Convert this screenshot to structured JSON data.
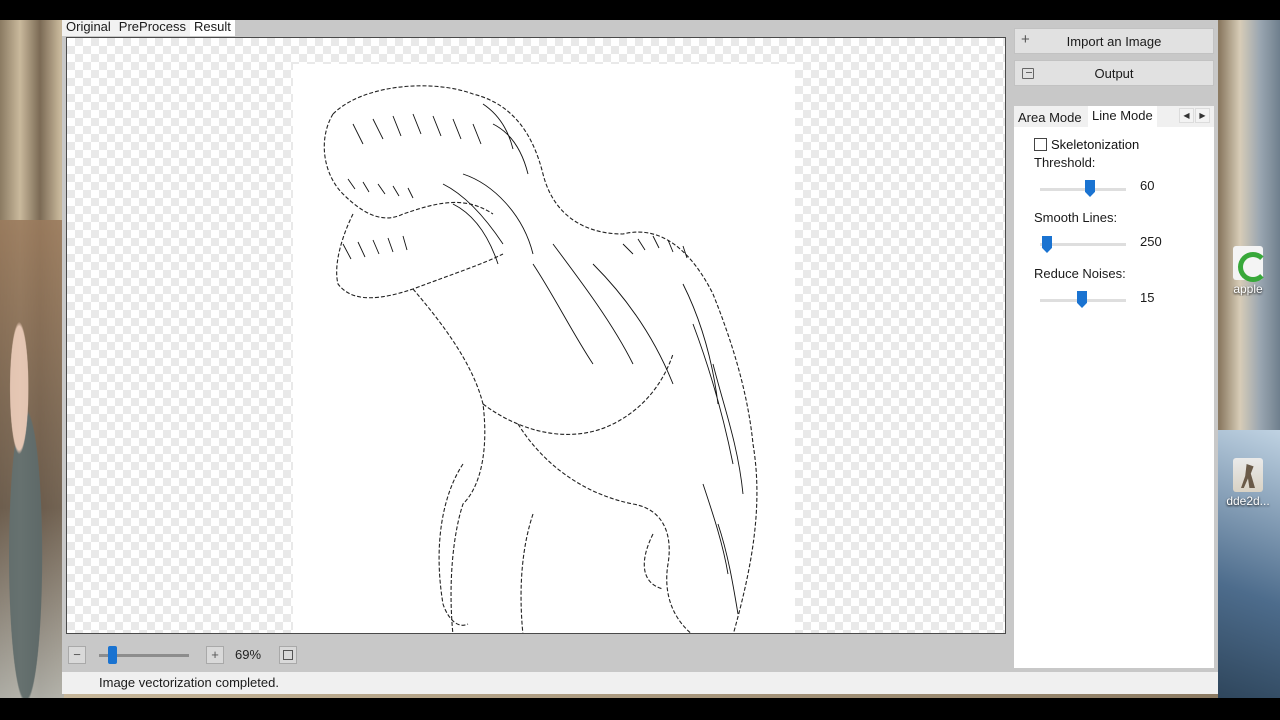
{
  "view_tabs": [
    "Original",
    "PreProcess",
    "Result"
  ],
  "active_view_tab": "Result",
  "sidebar": {
    "import_label": "Import an Image",
    "import_icon": "plus-icon",
    "output_label": "Output",
    "output_icon": "export-icon"
  },
  "mode_tabs": [
    "Area Mode",
    "Line Mode"
  ],
  "active_mode_tab": "Line Mode",
  "line_mode": {
    "skeletonization_label": "Skeletonization",
    "skeletonization_checked": false,
    "threshold": {
      "label": "Threshold:",
      "value": "60"
    },
    "smooth_lines": {
      "label": "Smooth Lines:",
      "value": "250"
    },
    "reduce_noises": {
      "label": "Reduce Noises:",
      "value": "15"
    }
  },
  "zoom": {
    "value": "69%"
  },
  "status": {
    "text": "Image vectorization completed."
  },
  "desktop_icons": [
    "apple",
    "dde2d..."
  ],
  "colors": {
    "accent": "#1a73d1",
    "panel_bg": "#c8c8c8",
    "status_bg": "#f0f0f0"
  }
}
